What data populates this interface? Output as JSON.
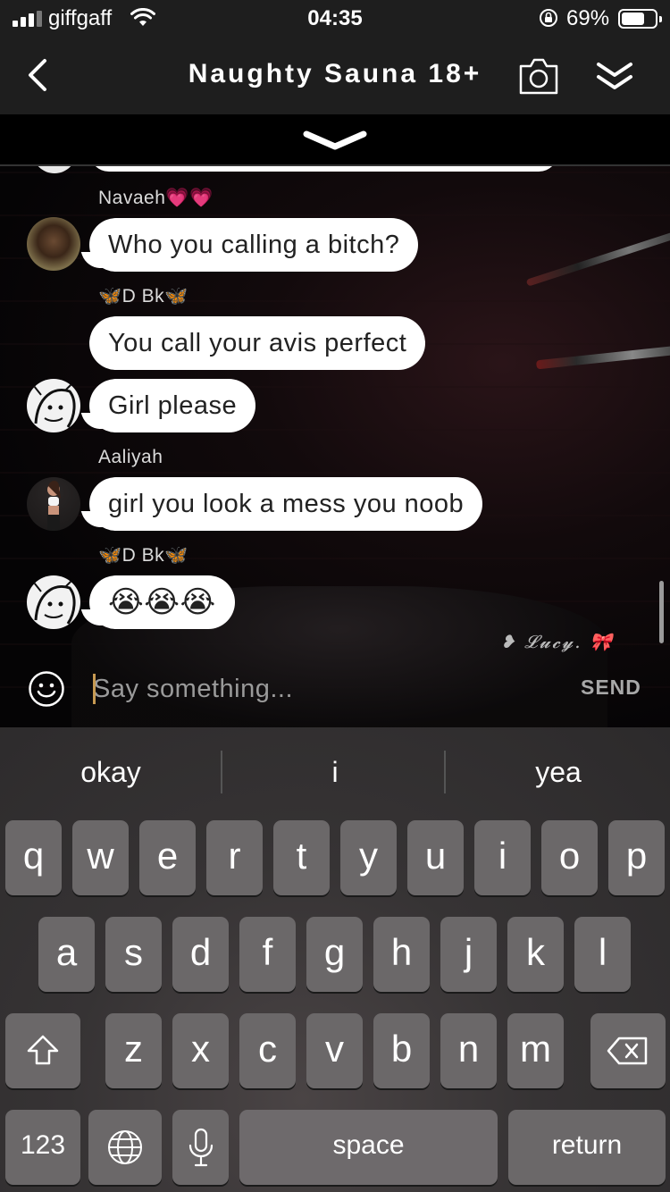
{
  "status_bar": {
    "carrier": "giffgaff",
    "time": "04:35",
    "battery_pct": "69%",
    "battery_level": 0.69
  },
  "header": {
    "title": "Naughty Sauna 18+"
  },
  "messages": [
    {
      "sender": "Navaeh💗💗",
      "text": "Who you calling a bitch?"
    },
    {
      "sender": "🦋D Bk🦋",
      "text": "You call your avis perfect"
    },
    {
      "sender": "",
      "text": "Girl please"
    },
    {
      "sender": "Aaliyah",
      "text": "girl you look a mess you noob"
    },
    {
      "sender": "🦋D Bk🦋",
      "text": "😭😭😭"
    }
  ],
  "watermark": "❥ 𝓛𝓾𝓬𝔂. 🎀",
  "composer": {
    "placeholder": "Say something...",
    "send_label": "SEND"
  },
  "keyboard": {
    "suggestions": [
      "okay",
      "i",
      "yea"
    ],
    "row1": [
      "q",
      "w",
      "e",
      "r",
      "t",
      "y",
      "u",
      "i",
      "o",
      "p"
    ],
    "row2": [
      "a",
      "s",
      "d",
      "f",
      "g",
      "h",
      "j",
      "k",
      "l"
    ],
    "row3": [
      "z",
      "x",
      "c",
      "v",
      "b",
      "n",
      "m"
    ],
    "numbers_label": "123",
    "space_label": "space",
    "return_label": "return"
  },
  "icons": {
    "status": [
      "signal-icon",
      "wifi-icon",
      "rotation-lock-icon",
      "battery-icon"
    ],
    "header": [
      "back-chevron-icon",
      "camera-icon",
      "double-chevron-down-icon"
    ],
    "keyboard": [
      "shift-icon",
      "delete-icon",
      "globe-icon",
      "microphone-icon"
    ]
  }
}
